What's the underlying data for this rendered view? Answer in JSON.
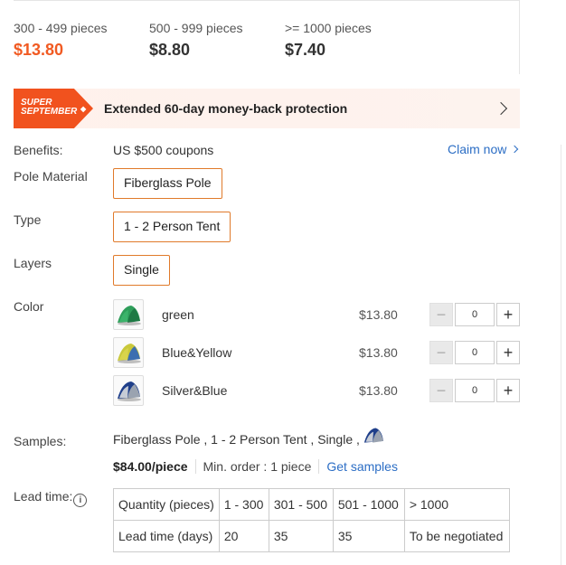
{
  "price_tiers": [
    {
      "range": "300 - 499 pieces",
      "price": "$13.80",
      "active": true
    },
    {
      "range": "500 - 999 pieces",
      "price": "$8.80",
      "active": false
    },
    {
      "range": ">= 1000 pieces",
      "price": "$7.40",
      "active": false
    }
  ],
  "promo": {
    "badge_line1": "SUPER",
    "badge_line2": "SEPTEMBER",
    "text": "Extended 60-day money-back protection"
  },
  "benefits": {
    "label": "Benefits:",
    "value": "US $500 coupons",
    "claim_label": "Claim now"
  },
  "pole_material": {
    "label": "Pole Material",
    "option": "Fiberglass Pole"
  },
  "type": {
    "label": "Type",
    "option": "1 - 2 Person Tent"
  },
  "layers": {
    "label": "Layers",
    "option": "Single"
  },
  "color": {
    "label": "Color",
    "items": [
      {
        "name": "green",
        "price": "$13.80",
        "qty": "0",
        "icon": "green-tent-icon"
      },
      {
        "name": "Blue&Yellow",
        "price": "$13.80",
        "qty": "0",
        "icon": "blue-yellow-tent-icon"
      },
      {
        "name": "Silver&Blue",
        "price": "$13.80",
        "qty": "0",
        "icon": "silver-blue-tent-icon"
      }
    ]
  },
  "samples": {
    "label": "Samples:",
    "spec": "Fiberglass Pole , 1 - 2 Person Tent , Single ,",
    "price": "$84.00/piece",
    "min_order": "Min. order : 1 piece",
    "link": "Get samples"
  },
  "lead_time": {
    "label": "Lead time:",
    "rows": [
      [
        "Quantity (pieces)",
        "1 - 300",
        "301 - 500",
        "501 - 1000",
        "> 1000"
      ],
      [
        "Lead time (days)",
        "20",
        "35",
        "35",
        "To be negotiated"
      ]
    ]
  },
  "colors": {
    "accent": "#f15a22",
    "link": "#2c6ec5",
    "option_border": "#e07a2a"
  }
}
